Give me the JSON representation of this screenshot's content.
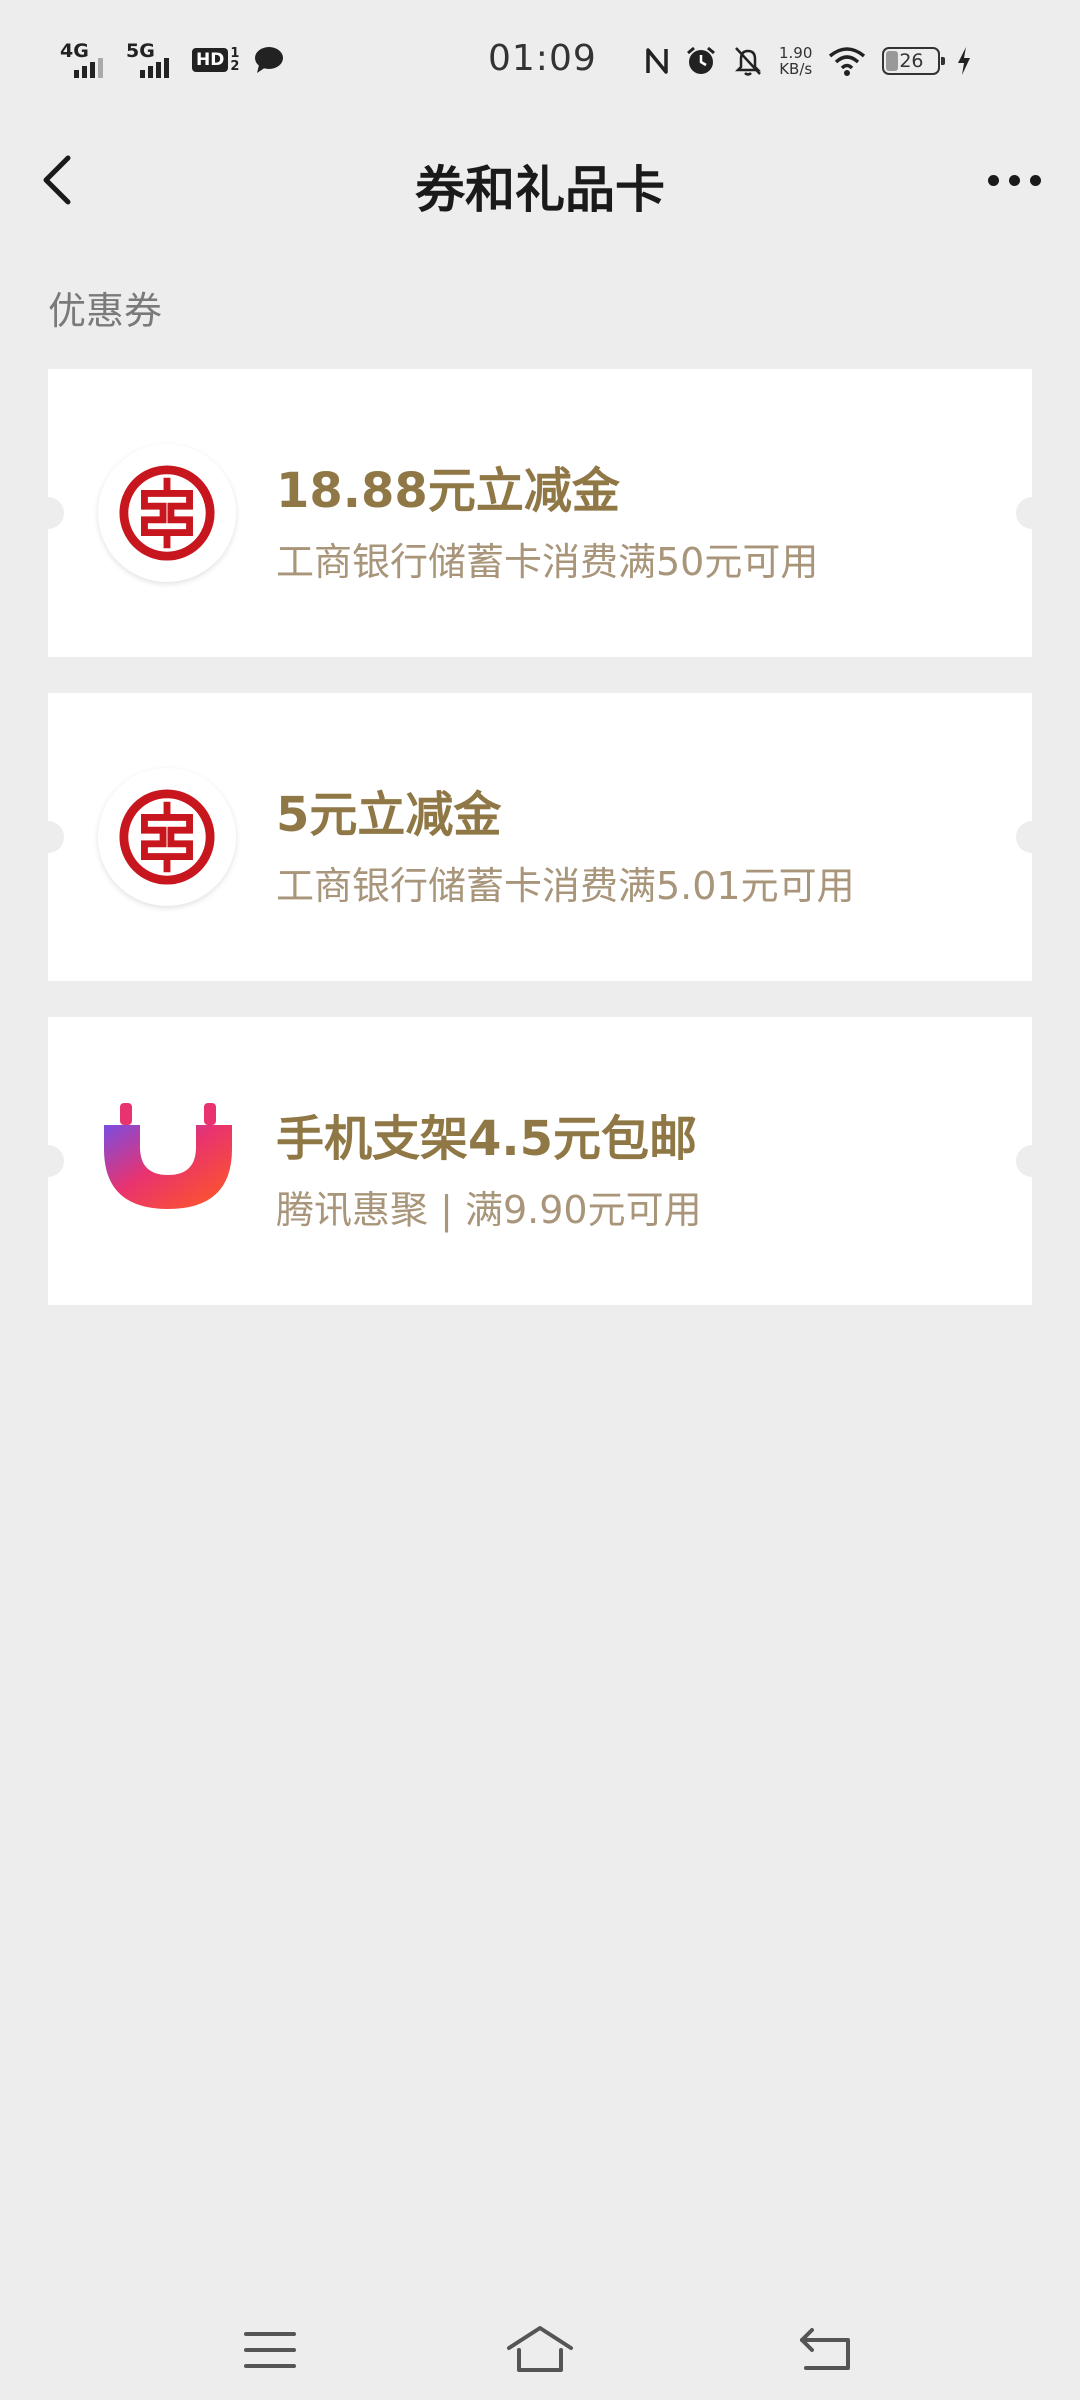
{
  "status_bar": {
    "net1": "4G",
    "net2": "5G",
    "hd": "HD",
    "hd_sub1": "1",
    "hd_sub2": "2",
    "time": "01:09",
    "speed_value": "1.90",
    "speed_unit": "KB/s",
    "battery": "26",
    "icons": [
      "signal-icon",
      "chat-icon",
      "nfc-icon",
      "alarm-icon",
      "mute-bell-icon",
      "wifi-icon",
      "battery-icon",
      "charging-icon"
    ]
  },
  "nav": {
    "title": "券和礼品卡",
    "back_icon": "back-chevron-icon",
    "more_icon": "more-dots-icon"
  },
  "section": {
    "title": "优惠券"
  },
  "coupons": [
    {
      "title": "18.88元立减金",
      "subtitle": "工商银行储蓄卡消费满50元可用",
      "logo": "icbc-logo"
    },
    {
      "title": "5元立减金",
      "subtitle": "工商银行储蓄卡消费满5.01元可用",
      "logo": "icbc-logo"
    },
    {
      "title": "手机支架4.5元包邮",
      "subtitle": "腾讯惠聚 | 满9.90元可用",
      "logo": "tencent-huiju-logo"
    }
  ],
  "colors": {
    "background": "#ededed",
    "card": "#ffffff",
    "coupon_title": "#8f7845",
    "coupon_subtitle": "#a8957a",
    "icbc_red": "#c7161e"
  },
  "bottom_nav": {
    "icons": [
      "menu-icon",
      "home-icon",
      "back-icon"
    ]
  }
}
